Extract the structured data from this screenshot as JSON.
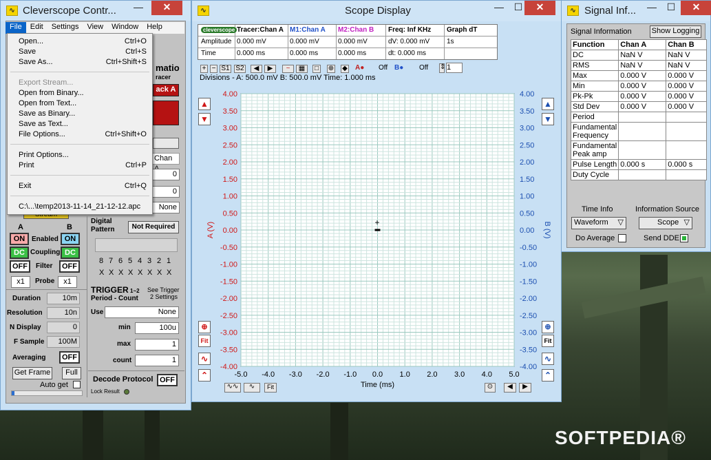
{
  "control_window": {
    "title": "Cleverscope Contr...",
    "menu": [
      "File",
      "Edit",
      "Settings",
      "View",
      "Window",
      "Help"
    ],
    "file_menu": [
      {
        "label": "Open...",
        "shortcut": "Ctrl+O",
        "disabled": false
      },
      {
        "label": "Save",
        "shortcut": "Ctrl+S",
        "disabled": false
      },
      {
        "label": "Save As...",
        "shortcut": "Ctrl+Shift+S",
        "disabled": false
      },
      {
        "label": "Export Stream...",
        "shortcut": "",
        "disabled": true
      },
      {
        "label": "Open from Binary...",
        "shortcut": "",
        "disabled": false
      },
      {
        "label": "Open from Text...",
        "shortcut": "",
        "disabled": false
      },
      {
        "label": "Save as Binary...",
        "shortcut": "",
        "disabled": false
      },
      {
        "label": "Save as Text...",
        "shortcut": "",
        "disabled": false
      },
      {
        "label": "File Options...",
        "shortcut": "Ctrl+Shift+O",
        "disabled": false
      },
      {
        "label": "Print Options...",
        "shortcut": "",
        "disabled": false
      },
      {
        "label": "Print",
        "shortcut": "Ctrl+P",
        "disabled": false
      },
      {
        "label": "Exit",
        "shortcut": "Ctrl+Q",
        "disabled": false
      },
      {
        "label": "C:\\...\\temp2013-11-14_21-12-12.apc",
        "shortcut": "",
        "disabled": false
      }
    ],
    "partial": {
      "automatio": "matio",
      "tracer": "racer",
      "track_a": "ack A",
      "chan_a": "Chan A",
      "stream": "Stream"
    },
    "fields": {
      "f1": "0",
      "f2": "0",
      "none1": "None"
    },
    "chan_a_label": "A",
    "chan_b_label": "B",
    "enabled_label": "Enabled",
    "coupling_label": "Coupling",
    "filter_label": "Filter",
    "probe_label": "Probe",
    "chan_a_enabled": "ON",
    "chan_b_enabled": "ON",
    "chan_a_coupling": "DC",
    "chan_b_coupling": "DC",
    "chan_a_filter": "OFF",
    "chan_b_filter": "OFF",
    "chan_a_probe": "x1",
    "chan_b_probe": "x1",
    "digital_label": "Digital",
    "pattern_label": "Pattern",
    "not_required": "Not Required",
    "bits": [
      "8",
      "7",
      "6",
      "5",
      "4",
      "3",
      "2",
      "1"
    ],
    "bit_states": [
      "X",
      "X",
      "X",
      "X",
      "X",
      "X",
      "X",
      "X"
    ],
    "duration_label": "Duration",
    "duration": "10m",
    "resolution_label": "Resolution",
    "resolution": "10n",
    "ndisplay_label": "N Display",
    "ndisplay": "0",
    "fsample_label": "F Sample",
    "fsample": "100M",
    "averaging_label": "Averaging",
    "averaging": "OFF",
    "get_frame": "Get Frame",
    "full": "Full",
    "auto_get": "Auto get",
    "trigger_label": "TRIGGER",
    "trigger_sub": "1~2",
    "period_count": "Period - Count",
    "see_trigger": "See Trigger",
    "settings2": "2 Settings",
    "use_label": "Use",
    "use_value": "None",
    "min_label": "min",
    "min_value": "100u",
    "max_label": "max",
    "max_value": "1",
    "count_label": "count",
    "count_value": "1",
    "decode_label": "Decode Protocol",
    "decode_value": "OFF",
    "lock_result": "Lock Result"
  },
  "scope_window": {
    "title": "Scope Display",
    "header": {
      "logo": "cleverscope",
      "cols": [
        "Tracer:Chan A",
        "M1:Chan A",
        "M2:Chan B",
        "Freq: Inf KHz",
        "Graph dT"
      ],
      "amplitude_label": "Amplitude",
      "time_label": "Time",
      "amplitude": [
        "0.000 mV",
        "0.000 mV",
        "0.000 mV",
        "dV: 0.000 mV",
        "1s"
      ],
      "time": [
        "0.000 ms",
        "0.000 ms",
        "0.000 ms",
        "dt:  0.000 ms",
        ""
      ]
    },
    "toolbar": {
      "off1": "Off",
      "off2": "Off",
      "page": "1",
      "s1": "S1",
      "s2": "S2"
    },
    "divisions": "Divisions -  A: 500.0 mV   B: 500.0 mV    Time: 1.000 ms",
    "fit": "Fit"
  },
  "info_window": {
    "title": "Signal Inf...",
    "section_label": "Signal Information",
    "show_logging": "Show Logging",
    "columns": [
      "Function",
      "Chan A",
      "Chan B"
    ],
    "rows": [
      [
        "DC",
        "NaN V",
        "NaN V"
      ],
      [
        "RMS",
        "NaN V",
        "NaN V"
      ],
      [
        "Max",
        "0.000 V",
        "0.000 V"
      ],
      [
        "Min",
        "0.000 V",
        "0.000 V"
      ],
      [
        "Pk-Pk",
        "0.000 V",
        "0.000 V"
      ],
      [
        "Std Dev",
        "0.000 V",
        "0.000 V"
      ],
      [
        "Period",
        "",
        ""
      ],
      [
        "Fundamental Frequency",
        "",
        ""
      ],
      [
        "Fundamental Peak amp",
        "",
        ""
      ],
      [
        "Pulse Length",
        "0.000 s",
        "0.000 s"
      ],
      [
        "Duty Cycle",
        "",
        ""
      ]
    ],
    "time_info_label": "Time Info",
    "info_source_label": "Information  Source",
    "time_info_value": "Waveform",
    "info_source_value": "Scope",
    "do_average": "Do Average",
    "send_dde": "Send DDE"
  },
  "watermark": "SOFTPEDIA®",
  "chart_data": {
    "type": "line",
    "xlabel": "Time (ms)",
    "ylabel": "A (V)",
    "y2label": "B (V)",
    "xlim": [
      -5.0,
      5.0
    ],
    "ylim": [
      -4.0,
      4.0
    ],
    "x_ticks": [
      "-5.0",
      "-4.0",
      "-3.0",
      "-2.0",
      "-1.0",
      "0.0",
      "1.0",
      "2.0",
      "3.0",
      "4.0",
      "5.0"
    ],
    "y_ticks": [
      "4.00",
      "3.50",
      "3.00",
      "2.50",
      "2.00",
      "1.50",
      "1.00",
      "0.50",
      "0.00",
      "-0.50",
      "-1.00",
      "-1.50",
      "-2.00",
      "-2.50",
      "-3.00",
      "-3.50",
      "-4.00"
    ],
    "grid": true,
    "series": [
      {
        "x": [
          -0.1,
          0.1
        ],
        "y": [
          0.0,
          0.0
        ]
      }
    ]
  }
}
